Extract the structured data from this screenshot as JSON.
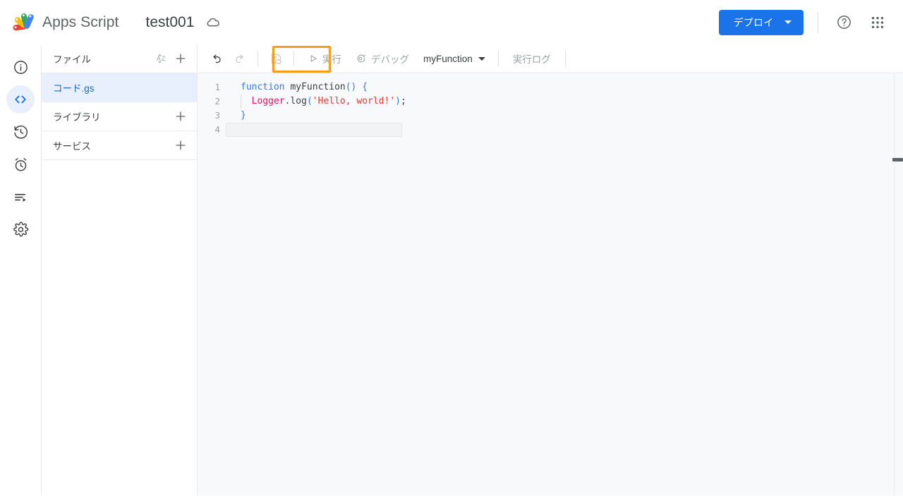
{
  "app": {
    "brand_name": "Apps Script",
    "project_title": "test001",
    "cloud_icon": "cloud-icon"
  },
  "topbar": {
    "deploy_label": "デプロイ",
    "deploy_caret_icon": "chevron-down-icon",
    "help_icon": "help-circle-icon",
    "apps_grid_icon": "apps-grid-icon",
    "deploy_color": "#1a73e8"
  },
  "rail": {
    "items": [
      {
        "name": "overview",
        "icon": "info-circle-icon",
        "active": false
      },
      {
        "name": "editor",
        "icon": "code-brackets-icon",
        "active": true
      },
      {
        "name": "history",
        "icon": "history-clock-icon",
        "active": false
      },
      {
        "name": "triggers",
        "icon": "alarm-clock-icon",
        "active": false
      },
      {
        "name": "executions",
        "icon": "list-play-icon",
        "active": false
      },
      {
        "name": "settings",
        "icon": "gear-icon",
        "active": false
      }
    ]
  },
  "filepanel": {
    "files_header": "ファイル",
    "sort_icon": "sort-az-icon",
    "add_file_icon": "plus-icon",
    "files": [
      {
        "label": "コード.gs",
        "selected": true
      }
    ],
    "libraries_header": "ライブラリ",
    "libraries_add_icon": "plus-icon",
    "services_header": "サービス",
    "services_add_icon": "plus-icon"
  },
  "toolbar": {
    "undo_icon": "undo-arrow-icon",
    "redo_icon": "redo-arrow-icon",
    "save_icon": "save-project-cloud-icon",
    "run_label": "実行",
    "run_icon": "play-triangle-icon",
    "debug_label": "デバッグ",
    "debug_icon": "debug-icon",
    "function_selected": "myFunction",
    "function_caret_icon": "chevron-down-icon",
    "execution_log_label": "実行ログ",
    "highlight_color": "#f99b1c",
    "highlight_target": "run-button"
  },
  "editor": {
    "line_numbers": [
      "1",
      "2",
      "3",
      "4"
    ],
    "code": {
      "line1": {
        "kw": "function",
        "space": " ",
        "fn": "myFunction",
        "parens": "()",
        "sp2": " ",
        "brace": "{"
      },
      "line2": {
        "indent": "  ",
        "obj": "Logger",
        "dot_prop": ".log",
        "open": "(",
        "str": "'Hello, world!'",
        "close": ")",
        "semi": ";"
      },
      "line3": {
        "brace": "}"
      },
      "line4": {
        "text": ""
      }
    },
    "current_line": 4,
    "scrollbar_icon": "horizontal-scroll-thumb"
  }
}
